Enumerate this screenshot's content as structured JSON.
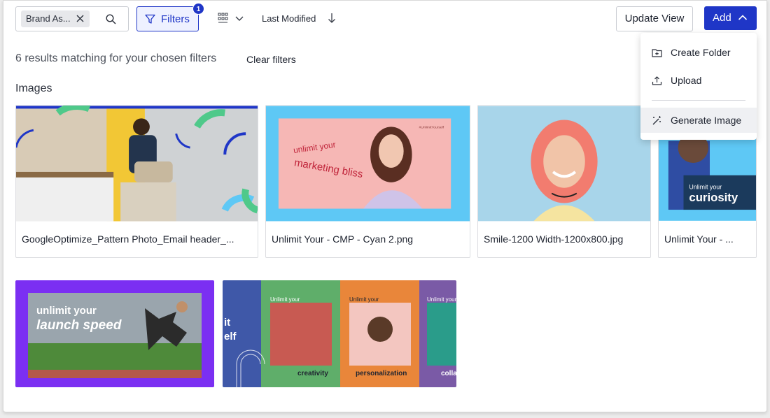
{
  "toolbar": {
    "chip_label": "Brand As...",
    "filters_label": "Filters",
    "filters_count": "1",
    "sort_label": "Last Modified",
    "update_view_label": "Update View",
    "add_label": "Add"
  },
  "results": {
    "summary": "6 results matching for your chosen filters",
    "clear_label": "Clear filters"
  },
  "section_title": "Images",
  "cards": [
    {
      "name": "GoogleOptimize_Pattern Photo_Email header_...",
      "thumb_text": ""
    },
    {
      "name": "Unlimit Your - CMP - Cyan 2.png",
      "thumb_text": "unlimit your marketing bliss"
    },
    {
      "name": "Smile-1200 Width-1200x800.jpg",
      "thumb_text": ""
    },
    {
      "name": "Unlimit Your - ...",
      "thumb_text": "Unlimit your curiosity"
    },
    {
      "name": "",
      "thumb_text": "unlimit your launch speed"
    },
    {
      "name": "",
      "thumb_text": "creativity personalization"
    }
  ],
  "thumbs": {
    "c2_tag": "#UnlimitYourself",
    "c2_line1": "unlimit your",
    "c2_line2": "marketing bliss",
    "c4_line1": "Unlimit your",
    "c4_line2": "curiosity",
    "c5_line1": "unlimit your",
    "c5_line2": "launch speed",
    "c6_left1": "it",
    "c6_left2": "elf",
    "c6_p1": "Unlimit your",
    "c6_p2": "Unlimit your",
    "c6_p3": "Unlimit your",
    "c6_word1": "creativity",
    "c6_word2": "personalization",
    "c6_word3": "colla"
  },
  "menu": {
    "items": [
      {
        "label": "Create Folder",
        "icon": "folder-plus-icon"
      },
      {
        "label": "Upload",
        "icon": "upload-icon"
      },
      {
        "label": "Generate Image",
        "icon": "magic-wand-icon"
      }
    ]
  },
  "colors": {
    "primary": "#1f36c7",
    "cyan": "#5ec8f5",
    "purple": "#7b2ff2",
    "green": "#4fc98a"
  }
}
